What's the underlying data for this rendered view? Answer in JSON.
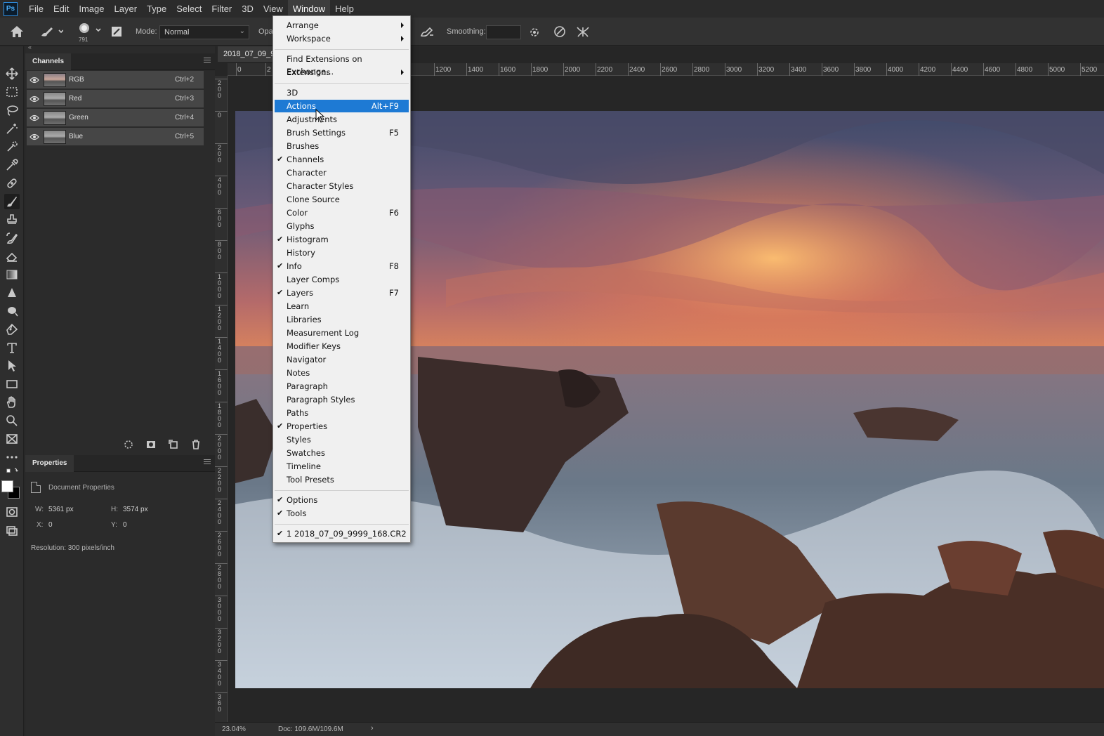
{
  "menubar": {
    "logo": "Ps",
    "items": [
      "File",
      "Edit",
      "Image",
      "Layer",
      "Type",
      "Select",
      "Filter",
      "3D",
      "View",
      "Window",
      "Help"
    ],
    "active": "Window"
  },
  "options_bar": {
    "brush_size": "791",
    "mode_label": "Mode:",
    "mode_value": "Normal",
    "opacity_label": "Opa",
    "smoothing_label": "Smoothing:",
    "smoothing_value": ""
  },
  "channels_panel": {
    "title": "Channels",
    "rows": [
      {
        "name": "RGB",
        "shortcut": "Ctrl+2",
        "color": true
      },
      {
        "name": "Red",
        "shortcut": "Ctrl+3",
        "color": false
      },
      {
        "name": "Green",
        "shortcut": "Ctrl+4",
        "color": false
      },
      {
        "name": "Blue",
        "shortcut": "Ctrl+5",
        "color": false
      }
    ]
  },
  "properties_panel": {
    "title": "Properties",
    "doc_label": "Document Properties",
    "w_label": "W:",
    "w_value": "5361 px",
    "h_label": "H:",
    "h_value": "3574 px",
    "x_label": "X:",
    "x_value": "0",
    "y_label": "Y:",
    "y_value": "0",
    "resolution": "Resolution: 300 pixels/inch"
  },
  "document": {
    "tab_title": "2018_07_09_9",
    "ruler_top_labels": [
      "0",
      "2",
      "1200",
      "1400",
      "1600",
      "1800",
      "2000",
      "2200",
      "2400",
      "2600",
      "2800",
      "3000",
      "3200",
      "3400",
      "3600",
      "3800",
      "4000",
      "4200",
      "4400",
      "4600",
      "4800",
      "5000",
      "5200"
    ],
    "ruler_left_labels": [
      "2\n0\n0",
      "0",
      "2\n0\n0",
      "4\n0\n0",
      "6\n0\n0",
      "8\n0\n0",
      "1\n0\n0\n0",
      "1\n2\n0\n0",
      "1\n4\n0\n0",
      "1\n6\n0\n0",
      "1\n8\n0\n0",
      "2\n0\n0\n0",
      "2\n2\n0\n0",
      "2\n4\n0\n0",
      "2\n6\n0\n0",
      "2\n8\n0\n0",
      "3\n0\n0\n0",
      "3\n2\n0\n0",
      "3\n4\n0\n0",
      "3\n6\n0"
    ],
    "zoom": "23.04%",
    "doc_size": "Doc: 109.6M/109.6M"
  },
  "window_menu": {
    "groups": [
      [
        {
          "label": "Arrange",
          "submenu": true
        },
        {
          "label": "Workspace",
          "submenu": true
        }
      ],
      [
        {
          "label": "Find Extensions on Exchange..."
        },
        {
          "label": "Extensions",
          "submenu": true
        }
      ],
      [
        {
          "label": "3D"
        },
        {
          "label": "Actions",
          "shortcut": "Alt+F9",
          "highlighted": true
        },
        {
          "label": "Adjustments"
        },
        {
          "label": "Brush Settings",
          "shortcut": "F5"
        },
        {
          "label": "Brushes"
        },
        {
          "label": "Channels",
          "checked": true
        },
        {
          "label": "Character"
        },
        {
          "label": "Character Styles"
        },
        {
          "label": "Clone Source"
        },
        {
          "label": "Color",
          "shortcut": "F6"
        },
        {
          "label": "Glyphs"
        },
        {
          "label": "Histogram",
          "checked": true
        },
        {
          "label": "History"
        },
        {
          "label": "Info",
          "shortcut": "F8",
          "checked": true
        },
        {
          "label": "Layer Comps"
        },
        {
          "label": "Layers",
          "shortcut": "F7",
          "checked": true
        },
        {
          "label": "Learn"
        },
        {
          "label": "Libraries"
        },
        {
          "label": "Measurement Log"
        },
        {
          "label": "Modifier Keys"
        },
        {
          "label": "Navigator"
        },
        {
          "label": "Notes"
        },
        {
          "label": "Paragraph"
        },
        {
          "label": "Paragraph Styles"
        },
        {
          "label": "Paths"
        },
        {
          "label": "Properties",
          "checked": true
        },
        {
          "label": "Styles"
        },
        {
          "label": "Swatches"
        },
        {
          "label": "Timeline"
        },
        {
          "label": "Tool Presets"
        }
      ],
      [
        {
          "label": "Options",
          "checked": true
        },
        {
          "label": "Tools",
          "checked": true
        }
      ],
      [
        {
          "label": "1 2018_07_09_9999_168.CR2",
          "checked": true
        }
      ]
    ]
  },
  "tools": [
    "move-tool-icon",
    "marquee-tool-icon",
    "lasso-tool-icon",
    "magic-wand-icon",
    "crop-tool-icon",
    "eyedropper-icon",
    "healing-brush-icon",
    "brush-tool-icon",
    "clone-stamp-icon",
    "history-brush-icon",
    "eraser-icon",
    "gradient-icon",
    "blur-icon",
    "dodge-icon",
    "pen-tool-icon",
    "type-tool-icon",
    "path-select-icon",
    "rectangle-tool-icon",
    "hand-tool-icon",
    "zoom-tool-icon",
    "frame-tool-icon",
    "more-tools-icon"
  ],
  "colors": {
    "menu_highlight": "#1e7ad4",
    "panel_bg": "#2b2b2b",
    "app_bg": "#282828"
  }
}
